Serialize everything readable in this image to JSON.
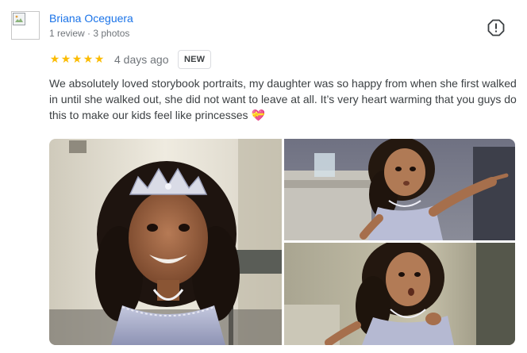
{
  "reviewer": {
    "name": "Briana Oceguera",
    "meta": "1 review · 3 photos"
  },
  "rating": {
    "stars": 5,
    "star_glyph": "★",
    "star_color": "#fbbc04"
  },
  "review": {
    "date": "4 days ago",
    "badge": "NEW",
    "text": "We absolutely loved storybook portraits, my daughter was so happy from when she first walked in until she walked out, she did not want to leave at all. It’s very heart warming that you guys do this to make our kids feel like princesses 💝"
  },
  "icons": {
    "report": "report-icon",
    "avatar": "broken-image-icon"
  },
  "colors": {
    "name_link": "#1a73e8",
    "muted": "#70757a",
    "text": "#3c4043"
  }
}
